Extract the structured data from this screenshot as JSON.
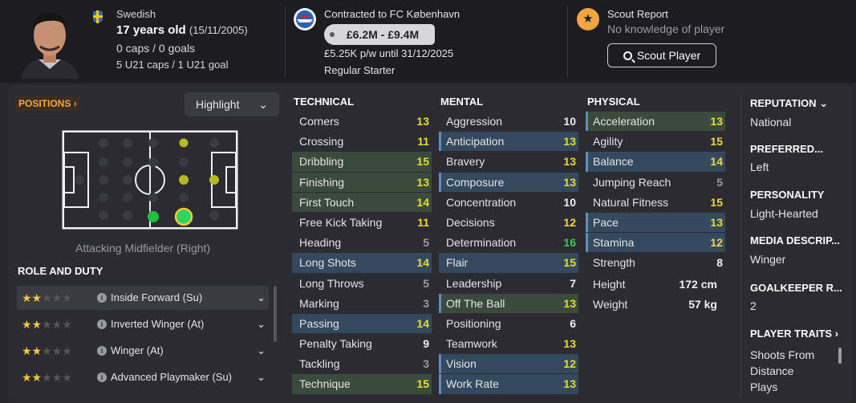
{
  "header": {
    "nationality": "Swedish",
    "age": "17 years old",
    "dob": "(15/11/2005)",
    "caps": "0 caps / 0 goals",
    "u21": "5 U21 caps / 1 U21 goal",
    "contract": "Contracted to FC København",
    "value_range": "£6.2M - £9.4M",
    "wage": "£5.25K p/w until 31/12/2025",
    "squad_status": "Regular Starter",
    "scout_title": "Scout Report",
    "scout_sub": "No knowledge of player",
    "scout_button": "Scout Player"
  },
  "left": {
    "positions_label": "POSITIONS",
    "highlight_label": "Highlight",
    "position_name": "Attacking Midfielder (Right)",
    "role_heading": "ROLE AND DUTY",
    "roles": [
      {
        "name": "Inside Forward (Su)",
        "stars": 2
      },
      {
        "name": "Inverted Winger (At)",
        "stars": 2
      },
      {
        "name": "Winger (At)",
        "stars": 2
      },
      {
        "name": "Advanced Playmaker (Su)",
        "stars": 2
      }
    ]
  },
  "technical": {
    "heading": "TECHNICAL",
    "attrs": [
      {
        "name": "Corners",
        "value": "13"
      },
      {
        "name": "Crossing",
        "value": "11"
      },
      {
        "name": "Dribbling",
        "value": "15"
      },
      {
        "name": "Finishing",
        "value": "13"
      },
      {
        "name": "First Touch",
        "value": "14"
      },
      {
        "name": "Free Kick Taking",
        "value": "11"
      },
      {
        "name": "Heading",
        "value": "5"
      },
      {
        "name": "Long Shots",
        "value": "14"
      },
      {
        "name": "Long Throws",
        "value": "5"
      },
      {
        "name": "Marking",
        "value": "3"
      },
      {
        "name": "Passing",
        "value": "14"
      },
      {
        "name": "Penalty Taking",
        "value": "9"
      },
      {
        "name": "Tackling",
        "value": "3"
      },
      {
        "name": "Technique",
        "value": "15"
      }
    ]
  },
  "mental": {
    "heading": "MENTAL",
    "attrs": [
      {
        "name": "Aggression",
        "value": "10"
      },
      {
        "name": "Anticipation",
        "value": "13"
      },
      {
        "name": "Bravery",
        "value": "13"
      },
      {
        "name": "Composure",
        "value": "13"
      },
      {
        "name": "Concentration",
        "value": "10"
      },
      {
        "name": "Decisions",
        "value": "12"
      },
      {
        "name": "Determination",
        "value": "16"
      },
      {
        "name": "Flair",
        "value": "15"
      },
      {
        "name": "Leadership",
        "value": "7"
      },
      {
        "name": "Off The Ball",
        "value": "13"
      },
      {
        "name": "Positioning",
        "value": "6"
      },
      {
        "name": "Teamwork",
        "value": "13"
      },
      {
        "name": "Vision",
        "value": "12"
      },
      {
        "name": "Work Rate",
        "value": "13"
      }
    ]
  },
  "physical": {
    "heading": "PHYSICAL",
    "attrs": [
      {
        "name": "Acceleration",
        "value": "13"
      },
      {
        "name": "Agility",
        "value": "15"
      },
      {
        "name": "Balance",
        "value": "14"
      },
      {
        "name": "Jumping Reach",
        "value": "5"
      },
      {
        "name": "Natural Fitness",
        "value": "15"
      },
      {
        "name": "Pace",
        "value": "13"
      },
      {
        "name": "Stamina",
        "value": "12"
      },
      {
        "name": "Strength",
        "value": "8"
      }
    ],
    "height_label": "Height",
    "height_value": "172 cm",
    "weight_label": "Weight",
    "weight_value": "57 kg"
  },
  "info": {
    "reputation_title": "REPUTATION",
    "reputation_value": "National",
    "foot_title": "PREFERRED...",
    "foot_value": "Left",
    "personality_title": "PERSONALITY",
    "personality_value": "Light-Hearted",
    "media_title": "MEDIA DESCRIP...",
    "media_value": "Winger",
    "gk_title": "GOALKEEPER R...",
    "gk_value": "2",
    "traits_title": "PLAYER TRAITS",
    "traits_line1": "Shoots From",
    "traits_line2": "Distance",
    "traits_line3": "Plays"
  },
  "colors": {
    "accent": "#f2a541",
    "attr_yellow": "#e8dc36",
    "attr_green": "#3ecb5c",
    "attr_gray": "#9a9aa2",
    "highlight_blue": "#34495e",
    "highlight_green": "#3a4a3c"
  }
}
